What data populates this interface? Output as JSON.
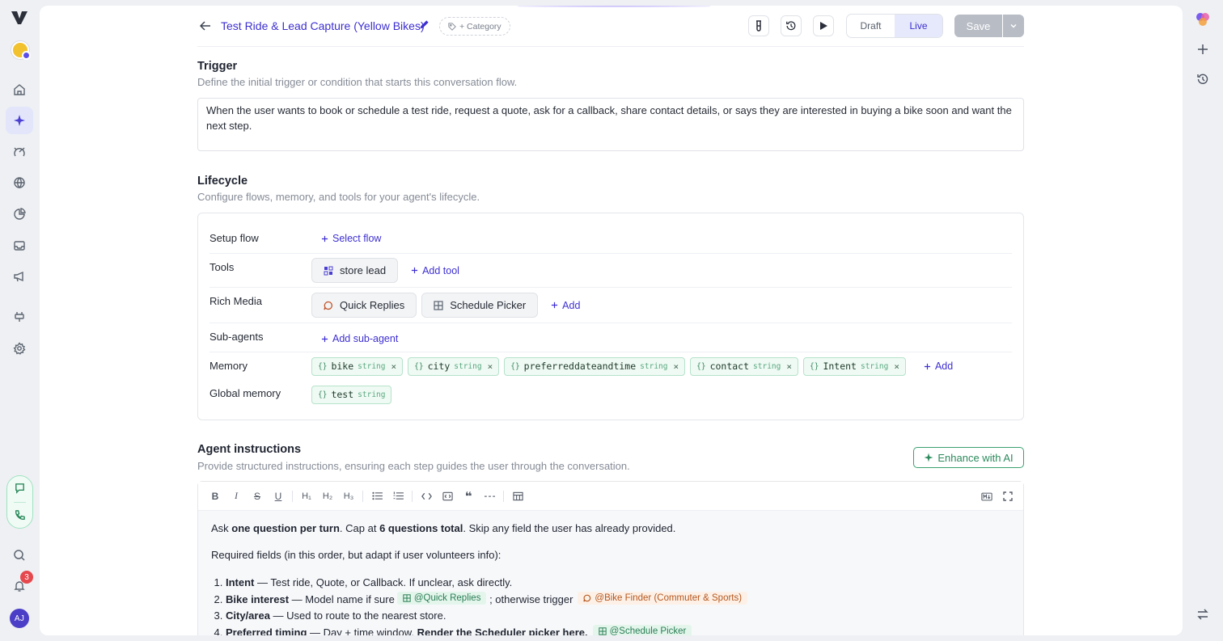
{
  "header": {
    "title": "Test Ride & Lead Capture (Yellow Bikes)",
    "category_label": "+ Category",
    "mode_draft": "Draft",
    "mode_live": "Live",
    "save_label": "Save"
  },
  "trigger": {
    "title": "Trigger",
    "subtitle": "Define the initial trigger or condition that starts this conversation flow.",
    "text": "When the user wants to book or schedule a test ride, request a quote, ask for a callback, share contact details, or says they are interested in buying a bike soon and want the next step."
  },
  "lifecycle": {
    "title": "Lifecycle",
    "subtitle": "Configure flows, memory, and tools for your agent's lifecycle.",
    "setup_flow": {
      "label": "Setup flow",
      "action": "Select flow"
    },
    "tools": {
      "label": "Tools",
      "items": [
        "store lead"
      ],
      "action": "Add tool"
    },
    "rich_media": {
      "label": "Rich Media",
      "items": [
        "Quick Replies",
        "Schedule Picker"
      ],
      "action": "Add"
    },
    "sub_agents": {
      "label": "Sub-agents",
      "action": "Add sub-agent"
    },
    "memory": {
      "label": "Memory",
      "items": [
        {
          "name": "bike",
          "type": "string"
        },
        {
          "name": "city",
          "type": "string"
        },
        {
          "name": "preferreddateandtime",
          "type": "string"
        },
        {
          "name": "contact",
          "type": "string"
        },
        {
          "name": "Intent",
          "type": "string"
        }
      ],
      "action": "Add"
    },
    "global_memory": {
      "label": "Global memory",
      "items": [
        {
          "name": "test",
          "type": "string"
        }
      ]
    }
  },
  "instructions": {
    "title": "Agent instructions",
    "subtitle": "Provide structured instructions, ensuring each step guides the user through the conversation.",
    "enhance_label": "Enhance with AI",
    "p1": {
      "a": "Ask ",
      "b": "one question per turn",
      "c": ". Cap at ",
      "d": "6 questions total",
      "e": ". Skip any field the user has already provided."
    },
    "p2": "Required fields (in this order, but adapt if user volunteers info):",
    "list": [
      {
        "bold": "Intent",
        "text": " — Test ride, Quote, or Callback. If unclear, ask directly."
      },
      {
        "bold": "Bike interest",
        "text": " — Model name if sure",
        "ref1": "@Quick Replies",
        "text2": "; otherwise trigger",
        "ref2": "@Bike Finder (Commuter & Sports)"
      },
      {
        "bold": "City/area",
        "text": " — Used to route to the nearest store."
      },
      {
        "bold": "Preferred timing",
        "text": " — Day + time window. ",
        "bold2": "Render the Scheduler picker here.",
        "ref1": "@Schedule Picker"
      }
    ]
  },
  "notifications": {
    "count": "3"
  },
  "user": {
    "initials": "AJ"
  },
  "colors": {
    "accent": "#3d2fd0",
    "memory_chip": "#eefaf3",
    "enhance": "#2c8a5c"
  }
}
